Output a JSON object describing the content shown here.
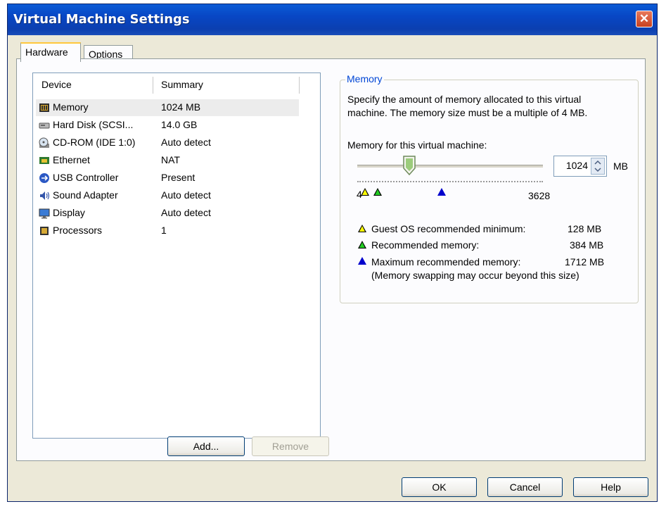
{
  "window": {
    "title": "Virtual Machine Settings",
    "close_glyph": "✕"
  },
  "tabs": [
    {
      "label": "Hardware",
      "active": true
    },
    {
      "label": "Options",
      "active": false
    }
  ],
  "device_list": {
    "headers": {
      "device": "Device",
      "summary": "Summary"
    },
    "rows": [
      {
        "name": "Memory",
        "summary": "1024 MB",
        "icon": "memory-icon",
        "selected": true
      },
      {
        "name": "Hard Disk (SCSI...",
        "summary": "14.0 GB",
        "icon": "hard-disk-icon"
      },
      {
        "name": "CD-ROM (IDE 1:0)",
        "summary": "Auto detect",
        "icon": "cdrom-icon"
      },
      {
        "name": "Ethernet",
        "summary": "NAT",
        "icon": "ethernet-icon"
      },
      {
        "name": "USB Controller",
        "summary": "Present",
        "icon": "usb-icon"
      },
      {
        "name": "Sound Adapter",
        "summary": "Auto detect",
        "icon": "sound-icon"
      },
      {
        "name": "Display",
        "summary": "Auto detect",
        "icon": "display-icon"
      },
      {
        "name": "Processors",
        "summary": "1",
        "icon": "processor-icon"
      }
    ],
    "add_label": "Add...",
    "remove_label": "Remove"
  },
  "memory": {
    "group_title": "Memory",
    "description_line1": "Specify the amount of memory allocated to this virtual",
    "description_line2": "machine. The memory size must be a multiple of 4 MB.",
    "field_label": "Memory for this virtual machine:",
    "value": "1024",
    "unit": "MB",
    "slider": {
      "min_label": "4",
      "max_label": "3628",
      "current_mb": 1024
    },
    "legend": [
      {
        "label": "Guest OS recommended minimum:",
        "value": "128 MB",
        "color": "#ffff00"
      },
      {
        "label": "Recommended memory:",
        "value": "384 MB",
        "color": "#22cc22"
      },
      {
        "label": "Maximum recommended memory:",
        "value": "1712 MB",
        "color": "#0000cc"
      }
    ],
    "swap_note": "(Memory swapping may occur beyond this size)"
  },
  "footer": {
    "ok_label": "OK",
    "cancel_label": "Cancel",
    "help_label": "Help"
  },
  "colors": {
    "title_bar": "#0a5bd6",
    "group_title": "#0046d5",
    "dialog_bg": "#ece9d8"
  }
}
